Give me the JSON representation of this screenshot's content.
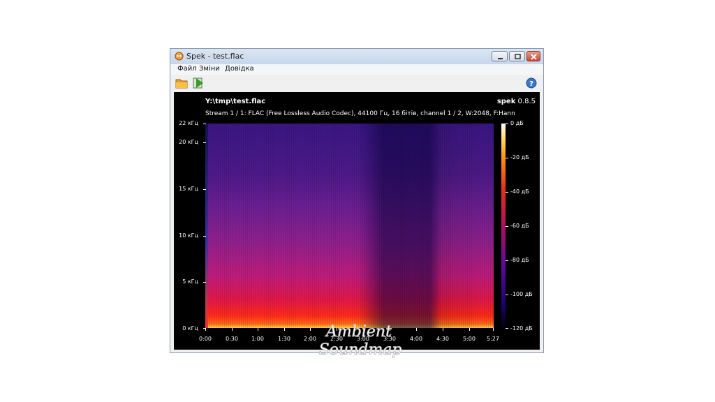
{
  "window": {
    "title": "Spek - test.flac",
    "menu": [
      "Файл",
      "Зміни",
      "Довідка"
    ],
    "toolbar": {
      "open_icon": "folder-open-icon",
      "save_icon": "save-export-icon",
      "help_icon": "help-icon"
    }
  },
  "viewer": {
    "file_path": "Y:\\tmp\\test.flac",
    "app_name": "spek",
    "app_version": "0.8.5",
    "stream_info": "Stream 1 / 1: FLAC (Free Lossless Audio Codec), 44100 Гц, 16 бітів, channel 1 / 2, W:2048, F:Hann",
    "y_axis_labels": [
      "22 кГц",
      "20 кГц",
      "15 кГц",
      "10 кГц",
      "5 кГц",
      "0 кГц"
    ],
    "x_axis_labels": [
      "0:00",
      "0:30",
      "1:00",
      "1:30",
      "2:00",
      "2:30",
      "3:00",
      "3:30",
      "4:00",
      "4:30",
      "5:00",
      "5:27"
    ],
    "colorbar_labels": [
      "0 дБ",
      "-20 дБ",
      "-40 дБ",
      "-60 дБ",
      "-80 дБ",
      "-100 дБ",
      "-120 дБ"
    ]
  },
  "watermark": {
    "line1": "Ambient",
    "line2": "Soundmap"
  },
  "colors": {
    "titlebar": "#c7d6ea",
    "viewer_bg": "#000000",
    "close_button": "#c44a32"
  }
}
